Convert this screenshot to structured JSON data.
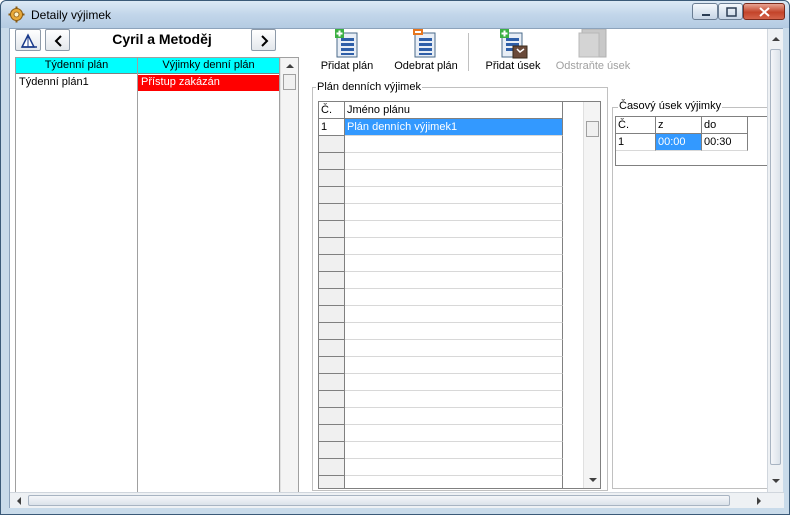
{
  "window": {
    "title": "Detaily výjimek"
  },
  "left_panel": {
    "person_name": "Cyril a Metoděj",
    "columns": [
      "Týdenní plán",
      "Výjimky denní plán"
    ],
    "rows": [
      {
        "weekly_plan": "Týdenní plán1",
        "exception_plan": "Přístup zakázán"
      }
    ]
  },
  "toolbar": {
    "add_plan_label": "Přidat plán",
    "remove_plan_label": "Odebrat plán",
    "add_segment_label": "Přidat úsek",
    "remove_segment_label": "Odstraňte úsek"
  },
  "daily_plan_group": {
    "legend": "Plán denních výjimek",
    "columns": [
      "Č.",
      "Jméno plánu"
    ],
    "rows": [
      {
        "number": "1",
        "name": "Plán denních výjimek1"
      }
    ]
  },
  "time_segment_group": {
    "legend": "Časový úsek výjimky",
    "columns": [
      "Č.",
      "z",
      "do"
    ],
    "rows": [
      {
        "number": "1",
        "from": "00:00",
        "to": "00:30"
      }
    ]
  },
  "colors": {
    "header_cyan": "#00ffff",
    "denied_red": "#ff0000",
    "selection_blue": "#3399ff"
  }
}
